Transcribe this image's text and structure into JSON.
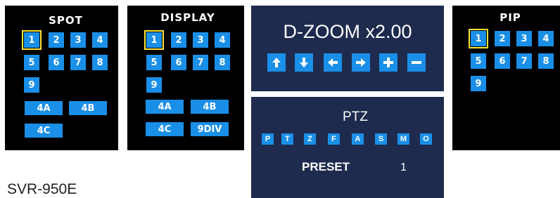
{
  "model": "SVR-950E",
  "spot": {
    "title": "SPOT",
    "numbers": [
      "1",
      "2",
      "3",
      "4",
      "5",
      "6",
      "7",
      "8",
      "9"
    ],
    "wide": [
      "4A",
      "4B",
      "4C"
    ],
    "selected": "1"
  },
  "display": {
    "title": "DISPLAY",
    "numbers": [
      "1",
      "2",
      "3",
      "4",
      "5",
      "6",
      "7",
      "8",
      "9"
    ],
    "wide": [
      "4A",
      "4B",
      "4C",
      "9DIV"
    ],
    "selected": "1"
  },
  "dzoom": {
    "title": "D-ZOOM x2.00",
    "buttons": [
      "up-arrow-icon",
      "down-arrow-icon",
      "left-arrow-icon",
      "right-arrow-icon",
      "plus-icon",
      "minus-icon"
    ]
  },
  "ptz": {
    "title": "PTZ",
    "buttons": [
      "P",
      "T",
      "Z",
      "F",
      "A",
      "S",
      "M",
      "O"
    ],
    "preset_label": "PRESET",
    "preset_value": "1"
  },
  "pip": {
    "title": "PIP",
    "numbers": [
      "1",
      "2",
      "3",
      "4",
      "5",
      "6",
      "7",
      "8",
      "9"
    ],
    "selected": "1"
  },
  "colors": {
    "button": "#1a8fe8",
    "selected_outline": "#ffe63a",
    "panel_black": "#000000",
    "panel_navy": "#1e2a4e"
  }
}
